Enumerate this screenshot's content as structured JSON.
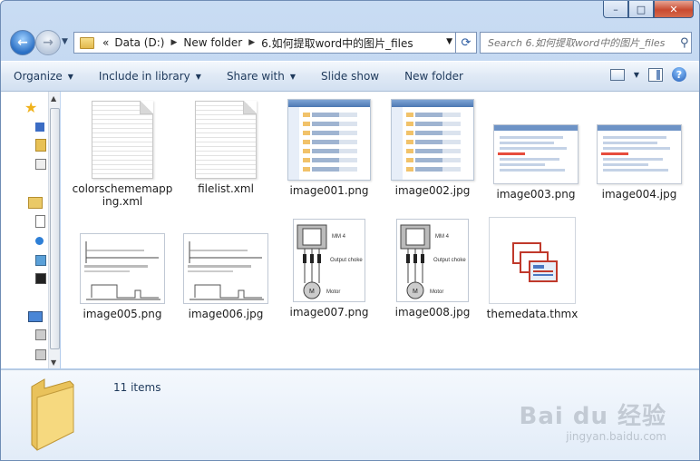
{
  "window": {
    "controls": {
      "minimize": "–",
      "maximize": "□",
      "close": "✕"
    }
  },
  "address_bar": {
    "overflow": "«",
    "segments": [
      "Data (D:)",
      "New folder",
      "6.如何提取word中的图片_files"
    ]
  },
  "search": {
    "placeholder": "Search 6.如何提取word中的图片_files"
  },
  "toolbar": {
    "organize": "Organize",
    "include_in_library": "Include in library",
    "share_with": "Share with",
    "slide_show": "Slide show",
    "new_folder": "New folder"
  },
  "files": [
    {
      "name": "colorschememapping.xml",
      "kind": "xml"
    },
    {
      "name": "filelist.xml",
      "kind": "xml"
    },
    {
      "name": "image001.png",
      "kind": "dialog"
    },
    {
      "name": "image002.jpg",
      "kind": "dialog"
    },
    {
      "name": "image003.png",
      "kind": "window"
    },
    {
      "name": "image004.jpg",
      "kind": "window"
    },
    {
      "name": "image005.png",
      "kind": "waveform"
    },
    {
      "name": "image006.jpg",
      "kind": "waveform"
    },
    {
      "name": "image007.png",
      "kind": "motor"
    },
    {
      "name": "image008.jpg",
      "kind": "motor"
    },
    {
      "name": "themedata.thmx",
      "kind": "theme"
    }
  ],
  "thumbnail_text": {
    "mm4": "MM 4",
    "output_choke": "Output choke",
    "motor": "Motor",
    "motor_symbol": "M"
  },
  "details": {
    "item_count": "11 items"
  },
  "watermark": {
    "brand": "Bai du 经验",
    "url": "jingyan.baidu.com"
  }
}
